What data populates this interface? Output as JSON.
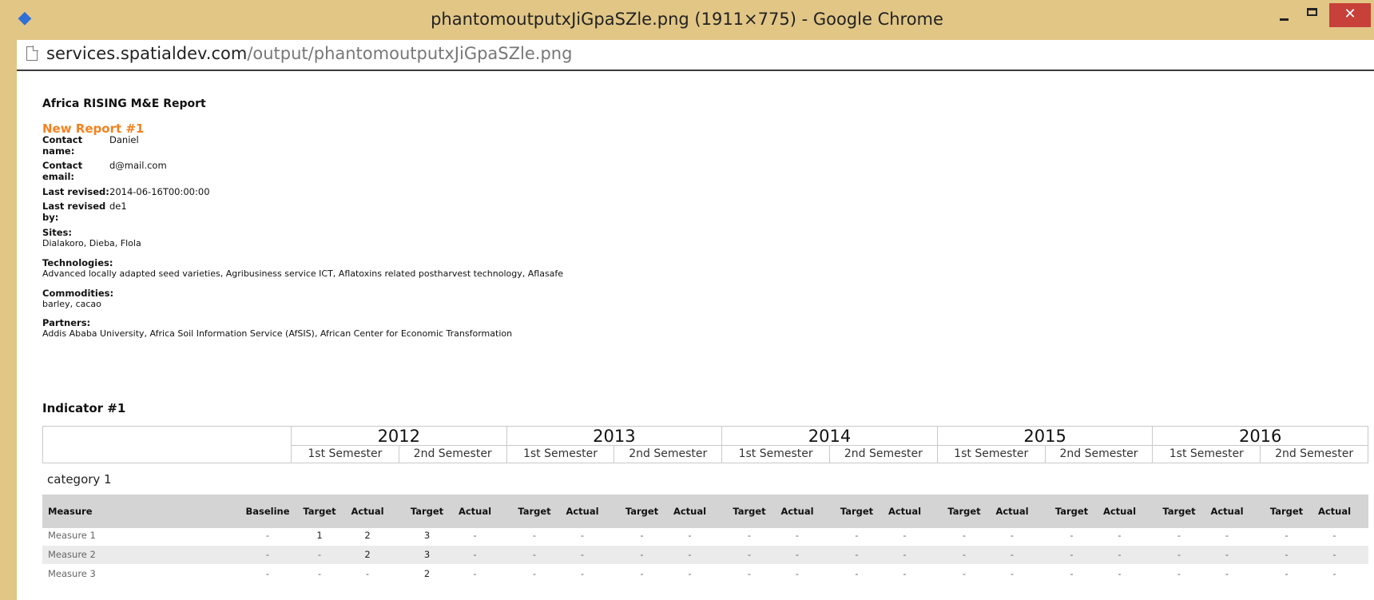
{
  "window": {
    "title": "phantomoutputxJiGpaSZle.png (1911×775) - Google Chrome",
    "close_glyph": "✕"
  },
  "address": {
    "host": "services.spatialdev.com",
    "path": "/output/phantomoutputxJiGpaSZle.png"
  },
  "report": {
    "title": "Africa RISING M&E Report",
    "subtitle": "New Report #1",
    "fields": [
      {
        "label": "Contact\nname:",
        "value": "Daniel"
      },
      {
        "label": "Contact\nemail:",
        "value": "d@mail.com"
      },
      {
        "label": "Last revised:",
        "value": "2014-06-16T00:00:00"
      },
      {
        "label": "Last revised\nby:",
        "value": "de1"
      }
    ],
    "sites": {
      "label": "Sites:",
      "value": "Dialakoro, Dieba, Flola"
    },
    "technologies": {
      "label": "Technologies:",
      "value": "Advanced locally adapted seed varieties, Agribusiness service ICT, Aflatoxins related postharvest technology, Aflasafe"
    },
    "commodities": {
      "label": "Commodities:",
      "value": "barley, cacao"
    },
    "partners": {
      "label": "Partners:",
      "value": "Addis Ababa University, Africa Soil Information Service (AfSIS), African Center for Economic Transformation"
    }
  },
  "indicator": {
    "title": "Indicator #1",
    "years": [
      "2012",
      "2013",
      "2014",
      "2015",
      "2016"
    ],
    "semesters": [
      "1st Semester",
      "2nd Semester"
    ],
    "category": "category 1",
    "columns": {
      "measure": "Measure",
      "baseline": "Baseline",
      "target": "Target",
      "actual": "Actual"
    },
    "rows": [
      {
        "name": "Measure 1",
        "values": [
          "-",
          "1",
          "2",
          "3",
          "-",
          "-",
          "-",
          "-",
          "-",
          "-",
          "-",
          "-",
          "-",
          "-",
          "-",
          "-",
          "-",
          "-",
          "-",
          "-",
          "-"
        ]
      },
      {
        "name": "Measure 2",
        "values": [
          "-",
          "-",
          "2",
          "3",
          "-",
          "-",
          "-",
          "-",
          "-",
          "-",
          "-",
          "-",
          "-",
          "-",
          "-",
          "-",
          "-",
          "-",
          "-",
          "-",
          "-"
        ]
      },
      {
        "name": "Measure 3",
        "values": [
          "-",
          "-",
          "-",
          "2",
          "-",
          "-",
          "-",
          "-",
          "-",
          "-",
          "-",
          "-",
          "-",
          "-",
          "-",
          "-",
          "-",
          "-",
          "-",
          "-",
          "-"
        ]
      }
    ]
  }
}
